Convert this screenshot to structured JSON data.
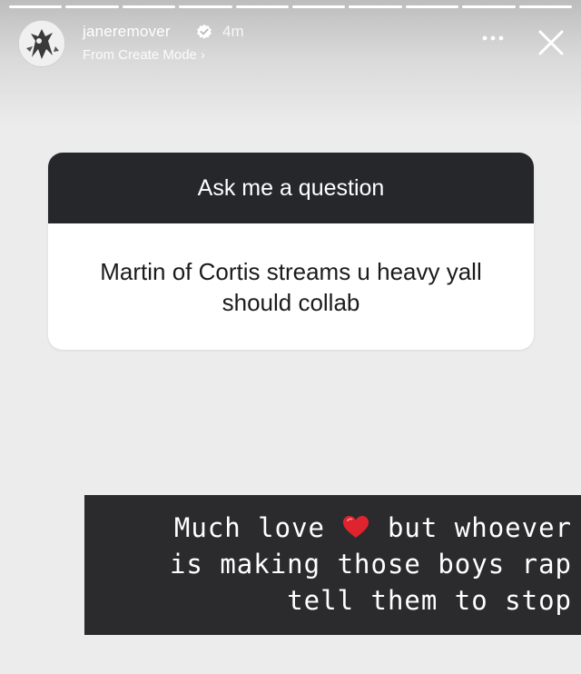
{
  "story": {
    "progress_segments": 10,
    "progress_completed": 10
  },
  "header": {
    "username": "janeremover",
    "time": "4m",
    "subtitle": "From Create Mode ›",
    "verified_icon": "verified-badge-icon",
    "more_icon": "more-dots-icon",
    "close_icon": "close-icon"
  },
  "question": {
    "title": "Ask me a question",
    "text": "Martin of Cortis streams u heavy yall should collab"
  },
  "reply": {
    "line1_before": "Much love",
    "line1_emoji": "heart-emoji",
    "line1_after": "but whoever",
    "line2": "is making those boys rap",
    "line3": "tell them to stop"
  },
  "colors": {
    "card_header_bg": "#26272b",
    "reply_bg": "#2b2b2d",
    "heart": "#e0242f"
  }
}
